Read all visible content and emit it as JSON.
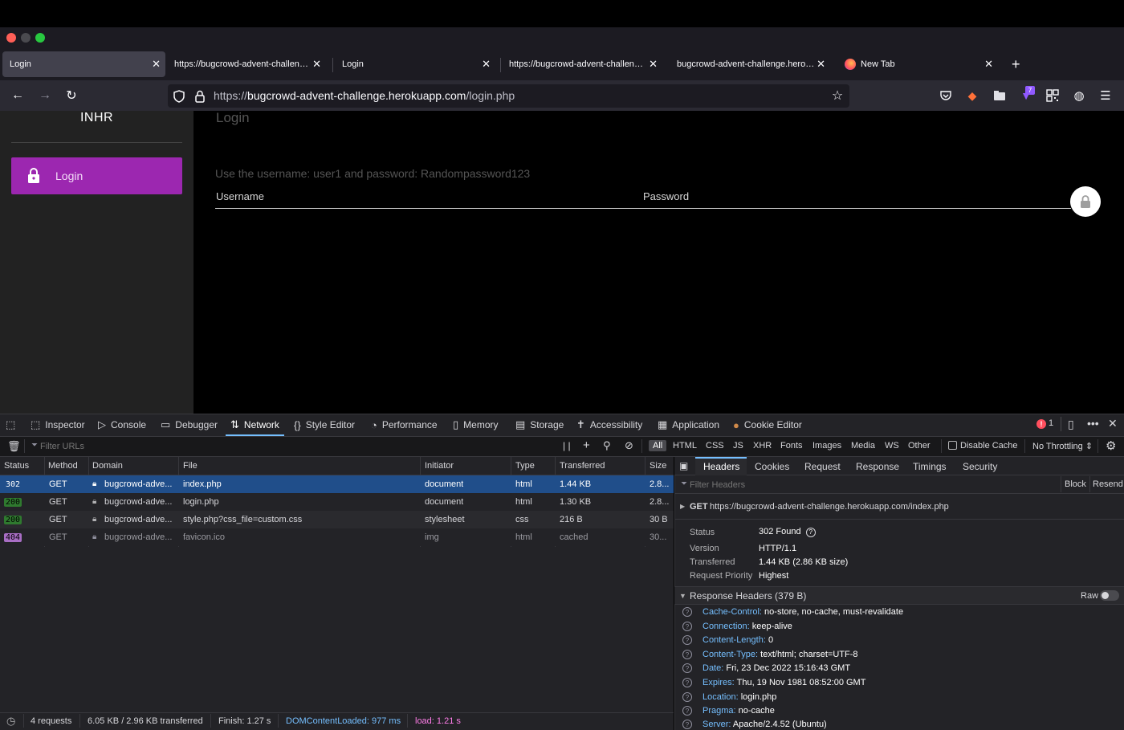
{
  "browser": {
    "tabs": [
      {
        "title": "Login",
        "active": true
      },
      {
        "title": "https://bugcrowd-advent-challenge.herokuapp.com/index.php"
      },
      {
        "title": "Login"
      },
      {
        "title": "https://bugcrowd-advent-challenge.herokuapp.com/index.php"
      },
      {
        "title": "bugcrowd-advent-challenge.herokuapp.com/index.php"
      },
      {
        "title": "New Tab"
      }
    ],
    "url_prefix": "https://",
    "url_host": "bugcrowd-advent-challenge.herokuapp.com",
    "url_path": "/login.php",
    "extension_badge": "7"
  },
  "page": {
    "brand": "INHR",
    "sidebar_login": "Login",
    "heading": "Login",
    "hint": "Use the username: user1 and password: Randompassword123",
    "username_label": "Username",
    "password_label": "Password",
    "accent_color": "#9c27b0"
  },
  "devtools": {
    "tools": [
      "Inspector",
      "Console",
      "Debugger",
      "Network",
      "Style Editor",
      "Performance",
      "Memory",
      "Storage",
      "Accessibility",
      "Application",
      "Cookie Editor"
    ],
    "active_tool": "Network",
    "error_count": "1",
    "filter_placeholder": "Filter URLs",
    "types": [
      "All",
      "HTML",
      "CSS",
      "JS",
      "XHR",
      "Fonts",
      "Images",
      "Media",
      "WS",
      "Other"
    ],
    "disable_cache": "Disable Cache",
    "throttling": "No Throttling",
    "columns": [
      "Status",
      "Method",
      "Domain",
      "File",
      "Initiator",
      "Type",
      "Transferred",
      "Size"
    ],
    "requests": [
      {
        "status": "302",
        "method": "GET",
        "domain": "bugcrowd-adve...",
        "file": "index.php",
        "initiator": "document",
        "type": "html",
        "transferred": "1.44 KB",
        "size": "2.8..."
      },
      {
        "status": "200",
        "method": "GET",
        "domain": "bugcrowd-adve...",
        "file": "login.php",
        "initiator": "document",
        "type": "html",
        "transferred": "1.30 KB",
        "size": "2.8..."
      },
      {
        "status": "200",
        "method": "GET",
        "domain": "bugcrowd-adve...",
        "file": "style.php?css_file=custom.css",
        "initiator": "stylesheet",
        "type": "css",
        "transferred": "216 B",
        "size": "30 B"
      },
      {
        "status": "404",
        "method": "GET",
        "domain": "bugcrowd-adve...",
        "file": "favicon.ico",
        "initiator": "img",
        "type": "html",
        "transferred": "cached",
        "size": "30..."
      }
    ],
    "detail_tabs": [
      "Headers",
      "Cookies",
      "Request",
      "Response",
      "Timings",
      "Security"
    ],
    "filter_headers": "Filter Headers",
    "block": "Block",
    "resend": "Resend",
    "request_line_method": "GET",
    "request_line_url": "https://bugcrowd-advent-challenge.herokuapp.com/index.php",
    "summary": [
      {
        "key": "Status",
        "value": "302 Found"
      },
      {
        "key": "Version",
        "value": "HTTP/1.1"
      },
      {
        "key": "Transferred",
        "value": "1.44 KB (2.86 KB size)"
      },
      {
        "key": "Request Priority",
        "value": "Highest"
      }
    ],
    "response_headers_title": "Response Headers (379 B)",
    "raw": "Raw",
    "response_headers": [
      {
        "name": "Cache-Control:",
        "value": "no-store, no-cache, must-revalidate"
      },
      {
        "name": "Connection:",
        "value": "keep-alive"
      },
      {
        "name": "Content-Length:",
        "value": "0"
      },
      {
        "name": "Content-Type:",
        "value": "text/html; charset=UTF-8"
      },
      {
        "name": "Date:",
        "value": "Fri, 23 Dec 2022 15:16:43 GMT"
      },
      {
        "name": "Expires:",
        "value": "Thu, 19 Nov 1981 08:52:00 GMT"
      },
      {
        "name": "Location:",
        "value": "login.php"
      },
      {
        "name": "Pragma:",
        "value": "no-cache"
      },
      {
        "name": "Server:",
        "value": "Apache/2.4.52 (Ubuntu)"
      }
    ],
    "status_bar": {
      "requests": "4 requests",
      "size": "6.05 KB / 2.96 KB transferred",
      "finish": "Finish: 1.27 s",
      "dom": "DOMContentLoaded: 977 ms",
      "load": "load: 1.21 s"
    }
  }
}
